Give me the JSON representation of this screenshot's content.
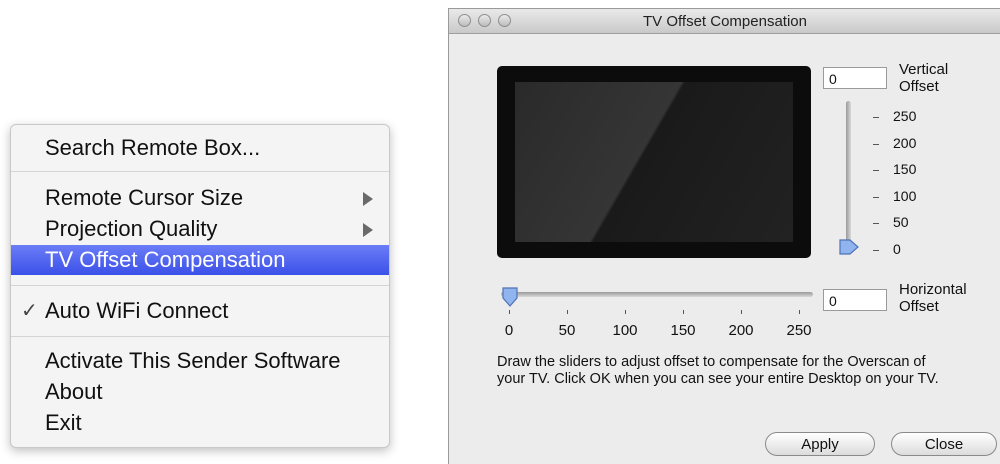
{
  "menu": {
    "items": [
      {
        "label": "Search Remote Box..."
      },
      {
        "label": "Remote Cursor Size",
        "has_submenu": true
      },
      {
        "label": "Projection Quality",
        "has_submenu": true
      },
      {
        "label": "TV Offset Compensation",
        "highlighted": true
      },
      {
        "label": "Auto WiFi Connect",
        "checked": true
      },
      {
        "label": "Activate This Sender Software"
      },
      {
        "label": "About"
      },
      {
        "label": "Exit"
      }
    ],
    "check_glyph": "✓",
    "highlight_color": "#4a5ef0"
  },
  "window": {
    "title": "TV Offset Compensation",
    "vertical": {
      "value": "0",
      "label_line1": "Vertical",
      "label_line2": "Offset",
      "ticks": [
        "250",
        "200",
        "150",
        "100",
        "50",
        "0"
      ],
      "slider_value": 0
    },
    "horizontal": {
      "value": "0",
      "label_line1": "Horizontal",
      "label_line2": "Offset",
      "ticks": [
        "0",
        "50",
        "100",
        "150",
        "200",
        "250"
      ],
      "slider_value": 0
    },
    "description": "Draw the sliders to adjust offset to compensate for the Overscan of your TV. Click OK when you can see your entire Desktop on your TV.",
    "apply_label": "Apply",
    "close_label": "Close"
  }
}
